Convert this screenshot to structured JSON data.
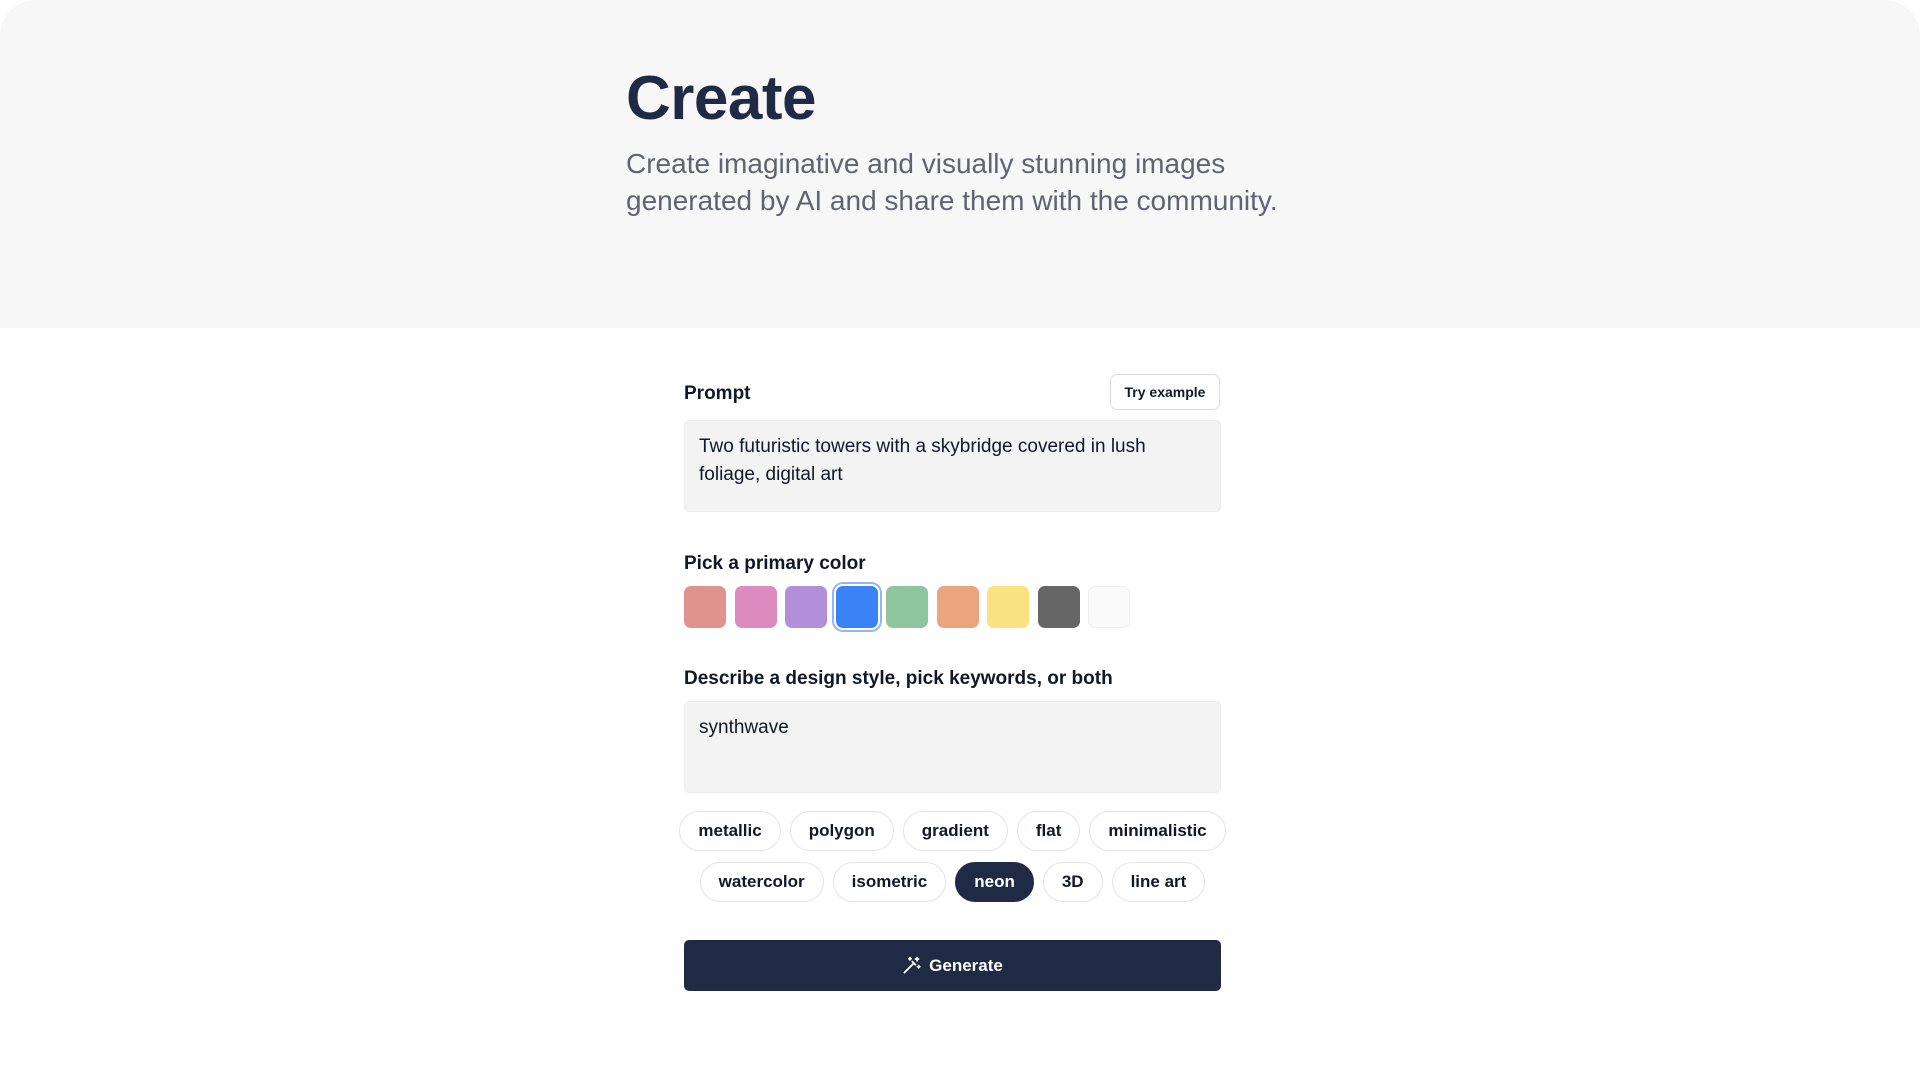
{
  "hero": {
    "title": "Create",
    "description": "Create imaginative and visually stunning images generated by AI and share them with the community."
  },
  "prompt": {
    "label": "Prompt",
    "try_example_label": "Try example",
    "value": "Two futuristic towers with a skybridge covered in lush foliage, digital art"
  },
  "color_picker": {
    "label": "Pick a primary color",
    "colors": [
      "#e0928f",
      "#db8bbf",
      "#b48fd9",
      "#3b82f6",
      "#8fc59c",
      "#eca47a",
      "#f9e27f",
      "#666666",
      "#fafafa"
    ],
    "selected_index": 3
  },
  "style": {
    "label": "Describe a design style, pick keywords, or both",
    "value": "synthwave"
  },
  "keywords": {
    "row1": [
      "metallic",
      "polygon",
      "gradient",
      "flat",
      "minimalistic"
    ],
    "row2": [
      "watercolor",
      "isometric",
      "neon",
      "3D",
      "line art"
    ],
    "active": "neon"
  },
  "generate_button": {
    "label": "Generate",
    "icon": "magic-wand-icon"
  }
}
